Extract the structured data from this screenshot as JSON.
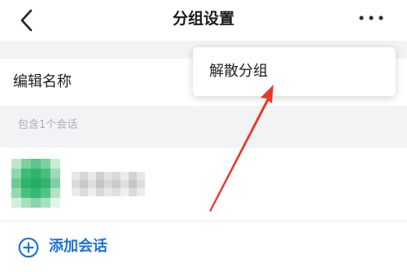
{
  "header": {
    "title": "分组设置",
    "back_icon": "chevron-left-icon",
    "more_icon": "more-horizontal-icon"
  },
  "settings": {
    "edit_name_label": "编辑名称"
  },
  "members": {
    "caption": "包含1个会话",
    "items": [
      {
        "avatar": "pixelated-avatar",
        "name_hidden": true
      }
    ]
  },
  "actions": {
    "add_label": "添加会话",
    "add_icon": "plus-circle-icon"
  },
  "menu": {
    "items": [
      {
        "label": "解散分组"
      }
    ]
  },
  "annotation": {
    "arrow_icon": "red-arrow-icon"
  },
  "colors": {
    "accent": "#1f73d6",
    "annotation": "#e8382c",
    "background": "#f2f3f5"
  }
}
